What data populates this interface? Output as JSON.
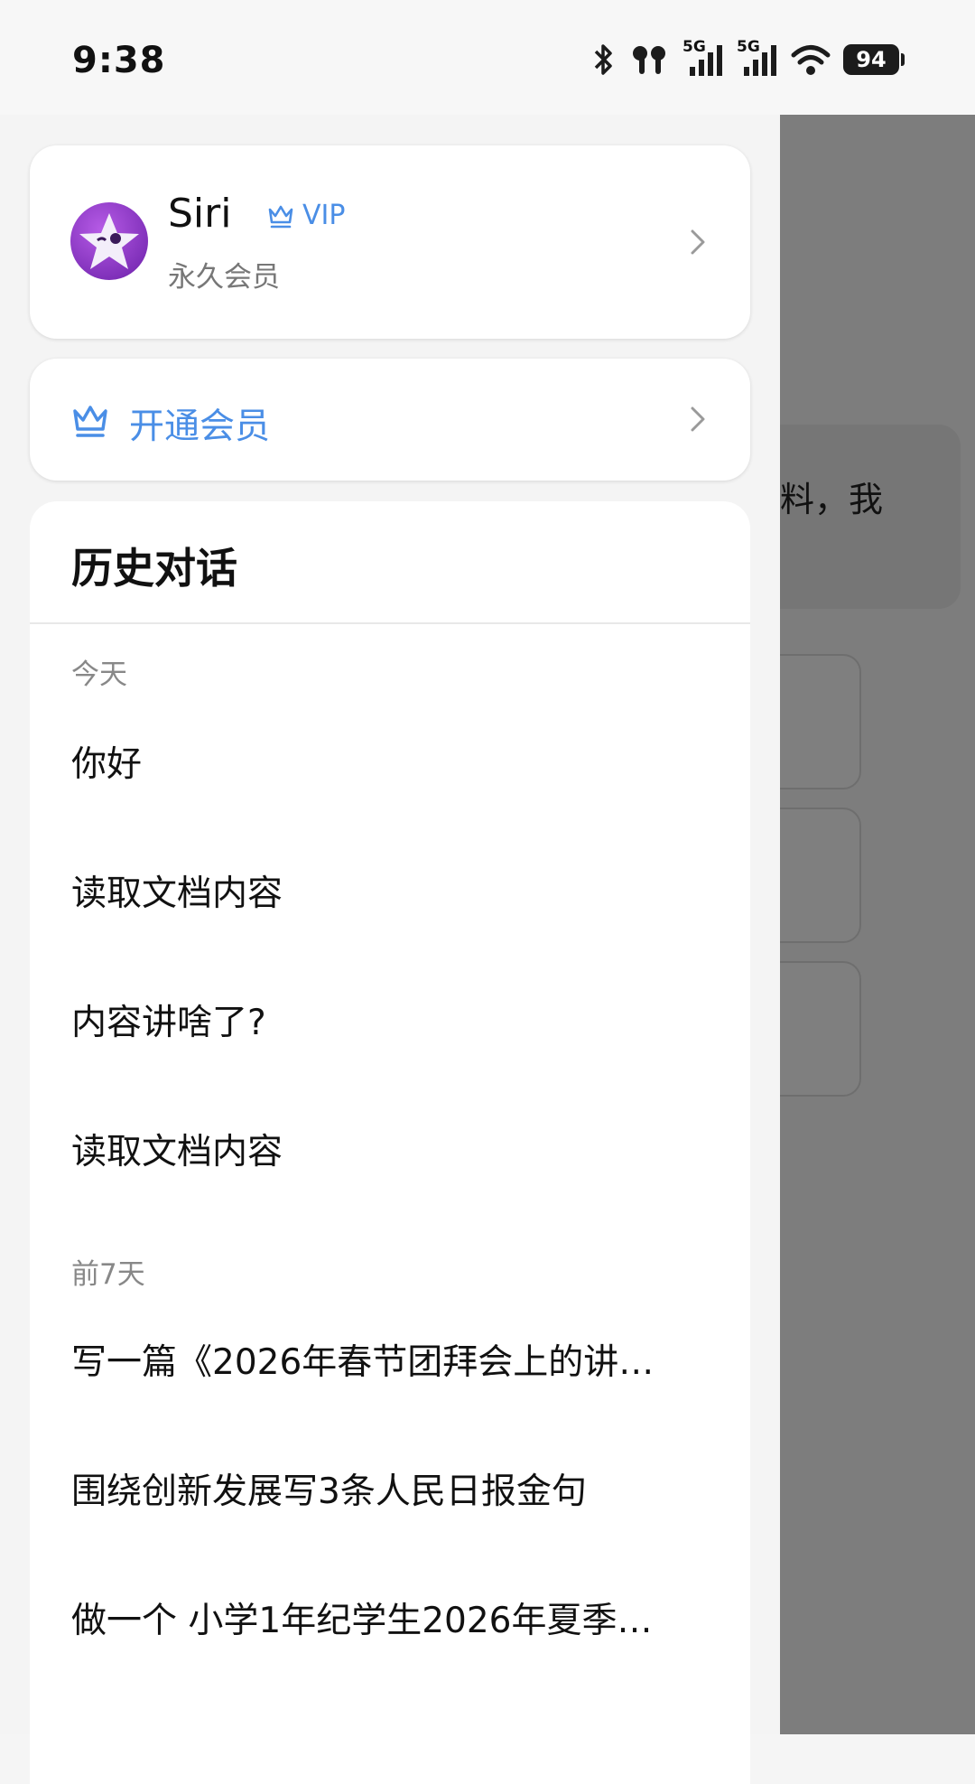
{
  "status_bar": {
    "time": "9:38",
    "battery": "94",
    "icons": [
      "bluetooth-icon",
      "earbuds-icon",
      "signal-5g-icon",
      "signal-5g-icon",
      "wifi-icon",
      "battery-icon"
    ],
    "network_label_1": "5G",
    "network_label_2": "5G"
  },
  "profile": {
    "name": "Siri",
    "badge": "VIP",
    "subtitle": "永久会员"
  },
  "membership": {
    "label": "开通会员"
  },
  "history": {
    "title": "历史对话",
    "sections": [
      {
        "label": "今天",
        "items": [
          "你好",
          "读取文档内容",
          "内容讲啥了?",
          "读取文档内容"
        ]
      },
      {
        "label": "前7天",
        "items": [
          "写一篇《2026年春节团拜会上的讲…",
          "围绕创新发展写3条人民日报金句",
          "做一个  小学1年纪学生2026年夏季…"
        ]
      }
    ]
  },
  "background": {
    "bubble_text": "料，我"
  },
  "colors": {
    "accent": "#4a8ee6",
    "overlay": "#7f7f7f",
    "drawer_bg": "#f4f4f4"
  }
}
